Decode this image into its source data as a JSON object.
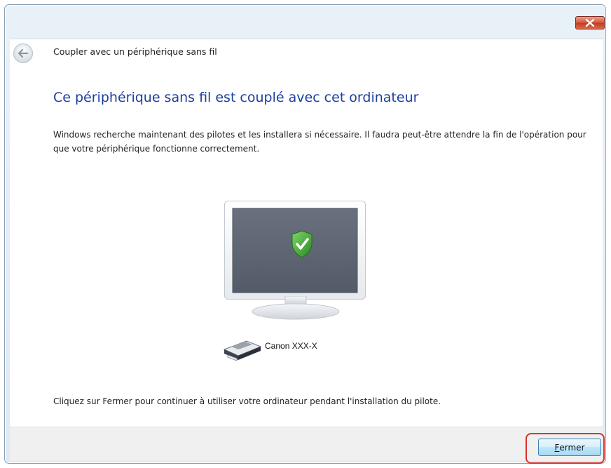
{
  "window": {
    "title": "Coupler avec un périphérique sans fil"
  },
  "main": {
    "heading": "Ce périphérique sans fil est couplé avec cet ordinateur",
    "description": "Windows recherche maintenant des pilotes et les installera si nécessaire. Il faudra peut-être attendre la fin de l'opération pour que votre périphérique fonctionne correctement.",
    "device_label": "Canon XXX-X",
    "footer_text": "Cliquez sur Fermer pour continuer à utiliser votre ordinateur pendant l'installation du pilote."
  },
  "buttons": {
    "close_accel": "F",
    "close_rest": "ermer"
  },
  "icons": {
    "back": "back-arrow-icon",
    "close": "close-icon",
    "monitor": "monitor-icon",
    "shield": "security-shield-check-icon",
    "printer": "printer-icon"
  },
  "colors": {
    "heading": "#1b3f9f",
    "highlight": "#d9342b",
    "close_button": "#c23a22",
    "monitor_screen": "#59606e",
    "shield": "#3f9b2c"
  }
}
